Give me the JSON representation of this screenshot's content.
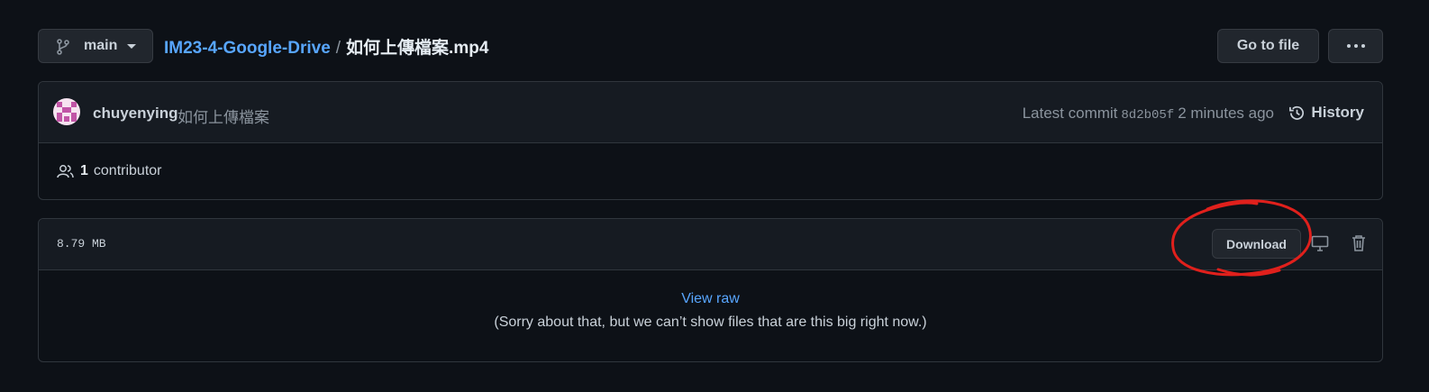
{
  "header": {
    "branch": "main",
    "repo_name": "IM23-4-Google-Drive",
    "separator": "/",
    "file_name": "如何上傳檔案.mp4",
    "go_to_file_label": "Go to file"
  },
  "commit": {
    "author": "chuyenying",
    "message": "如何上傳檔案",
    "latest_commit_label": "Latest commit",
    "sha": "8d2b05f",
    "time_ago": "2 minutes ago",
    "history_label": "History",
    "contributors_count": "1",
    "contributors_label": "contributor"
  },
  "file": {
    "size": "8.79 MB",
    "download_label": "Download",
    "view_raw_label": "View raw",
    "too_big_message": "(Sorry about that, but we can’t show files that are this big right now.)"
  },
  "colors": {
    "background": "#0d1117",
    "link": "#58a6ff",
    "annotation": "#e0201c"
  }
}
